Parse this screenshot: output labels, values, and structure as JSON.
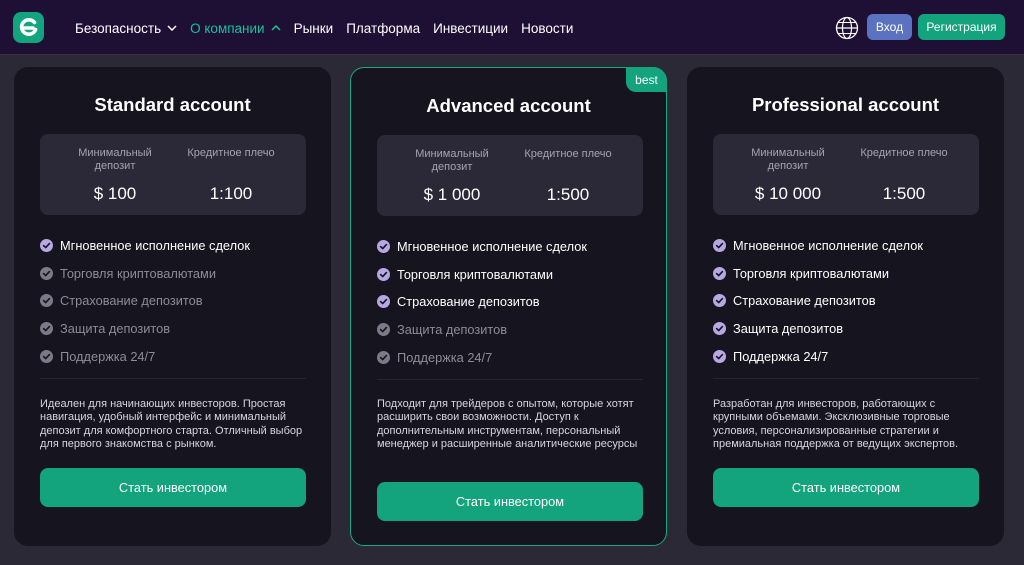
{
  "header": {
    "nav": [
      {
        "label": "Безопасность",
        "dropdown": "down",
        "active": false
      },
      {
        "label": "О компании",
        "dropdown": "up",
        "active": true
      },
      {
        "label": "Рынки"
      },
      {
        "label": "Платформа"
      },
      {
        "label": "Инвестиции"
      },
      {
        "label": "Новости"
      }
    ],
    "login_label": "Вход",
    "register_label": "Регистрация",
    "globe_icon": "globe-icon",
    "logo_icon": "brand-logo-icon"
  },
  "colors": {
    "accent": "#13a37d",
    "active_nav": "#16c39a",
    "login": "#5b72c0",
    "header_bg": "#1e0f35",
    "card_bg": "#15141f",
    "check_on": "#b9a7e3",
    "check_off": "#7c7a88"
  },
  "stats_labels": {
    "min_deposit": "Минимальный депозит",
    "leverage": "Кредитное плечо"
  },
  "cards": [
    {
      "title": "Standard account",
      "badge": "",
      "min_deposit": "$ 100",
      "leverage": "1:100",
      "features": [
        {
          "text": "Мгновенное исполнение сделок",
          "enabled": true
        },
        {
          "text": "Торговля криптовалютами",
          "enabled": false
        },
        {
          "text": "Страхование депозитов",
          "enabled": false
        },
        {
          "text": "Защита депозитов",
          "enabled": false
        },
        {
          "text": "Поддержка 24/7",
          "enabled": false
        }
      ],
      "description": "Идеален для начинающих инвесторов. Простая навигация, удобный интерфейс и минимальный депозит для комфортного старта. Отличный выбор для первого знакомства с рынком.",
      "cta": "Стать инвестором"
    },
    {
      "title": "Advanced account",
      "badge": "best",
      "min_deposit": "$ 1 000",
      "leverage": "1:500",
      "features": [
        {
          "text": "Мгновенное исполнение сделок",
          "enabled": true
        },
        {
          "text": "Торговля криптовалютами",
          "enabled": true
        },
        {
          "text": "Страхование депозитов",
          "enabled": true
        },
        {
          "text": "Защита депозитов",
          "enabled": false
        },
        {
          "text": "Поддержка 24/7",
          "enabled": false
        }
      ],
      "description": "Подходит для трейдеров с опытом, которые хотят расширить свои возможности. Доступ к дополнительным инструментам, персональный менеджер и расширенные аналитические ресурсы",
      "cta": "Стать инвестором"
    },
    {
      "title": "Professional account",
      "badge": "",
      "min_deposit": "$ 10 000",
      "leverage": "1:500",
      "features": [
        {
          "text": "Мгновенное исполнение сделок",
          "enabled": true
        },
        {
          "text": "Торговля криптовалютами",
          "enabled": true
        },
        {
          "text": "Страхование депозитов",
          "enabled": true
        },
        {
          "text": "Защита депозитов",
          "enabled": true
        },
        {
          "text": "Поддержка 24/7",
          "enabled": true
        }
      ],
      "description": "Разработан для инвесторов, работающих с крупными объемами. Эксклюзивные торговые условия, персонализированные стратегии и премиальная поддержка от ведущих экспертов.",
      "cta": "Стать инвестором"
    }
  ]
}
